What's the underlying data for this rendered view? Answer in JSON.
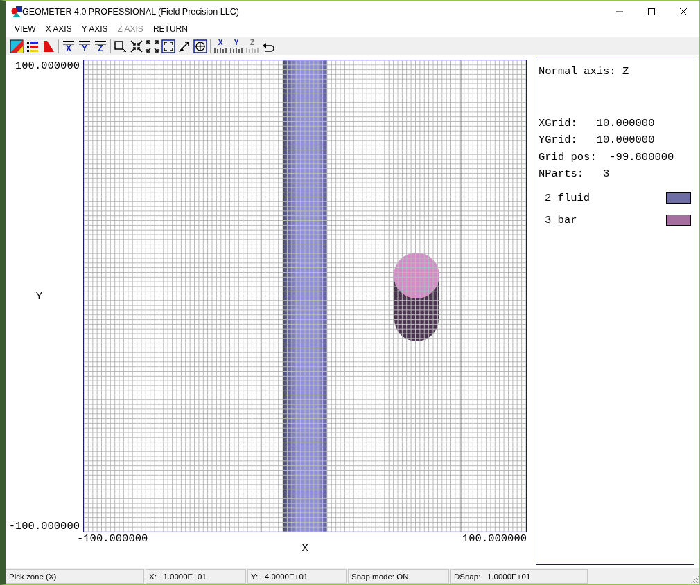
{
  "window": {
    "title": "GEOMETER 4.0 PROFESSIONAL (Field Precision LLC)"
  },
  "menu": [
    {
      "label": "VIEW",
      "disabled": false
    },
    {
      "label": "X AXIS",
      "disabled": false
    },
    {
      "label": "Y AXIS",
      "disabled": false
    },
    {
      "label": "Z AXIS",
      "disabled": true
    },
    {
      "label": "RETURN",
      "disabled": false
    }
  ],
  "toolbar": [
    [
      {
        "kind": "palette",
        "disabled": false
      },
      {
        "kind": "legend",
        "disabled": false
      },
      {
        "kind": "triangle",
        "disabled": false
      }
    ],
    [
      {
        "kind": "axis-bar",
        "glyph": "X",
        "disabled": false
      },
      {
        "kind": "axis-bar",
        "glyph": "Y",
        "disabled": false
      },
      {
        "kind": "axis-bar",
        "glyph": "Z",
        "disabled": false
      }
    ],
    [
      {
        "kind": "zoom-box",
        "disabled": false
      },
      {
        "kind": "shrink",
        "disabled": false
      },
      {
        "kind": "expand",
        "disabled": false
      },
      {
        "kind": "fit",
        "disabled": false
      },
      {
        "kind": "arrow",
        "disabled": false
      },
      {
        "kind": "crosshair",
        "disabled": false
      }
    ],
    [
      {
        "kind": "axis-ticks",
        "glyph": "X",
        "disabled": false
      },
      {
        "kind": "axis-ticks",
        "glyph": "Y",
        "disabled": false
      },
      {
        "kind": "axis-ticks",
        "glyph": "Z",
        "disabled": true
      },
      {
        "kind": "undo",
        "disabled": false
      }
    ]
  ],
  "plot": {
    "y_max": "100.000000",
    "y_min": "-100.000000",
    "y_label": "Y",
    "x_min": "-100.000000",
    "x_max": "100.000000",
    "x_label": "X"
  },
  "info": {
    "normal_axis": "Normal axis: Z",
    "lines": [
      "XGrid:   10.000000",
      "YGrid:   10.000000",
      "Grid pos:  -99.800000",
      "NParts:   3"
    ],
    "parts": [
      {
        "label": "2 fluid",
        "color": "#6e6ea4"
      },
      {
        "label": "3 bar",
        "color": "#a46e9e"
      }
    ]
  },
  "status_bar": [
    "Pick zone (X)",
    "X:   1.0000E+01",
    "Y:   4.0000E+01",
    "Snap mode: ON",
    "DSnap:   1.0000E+01"
  ]
}
